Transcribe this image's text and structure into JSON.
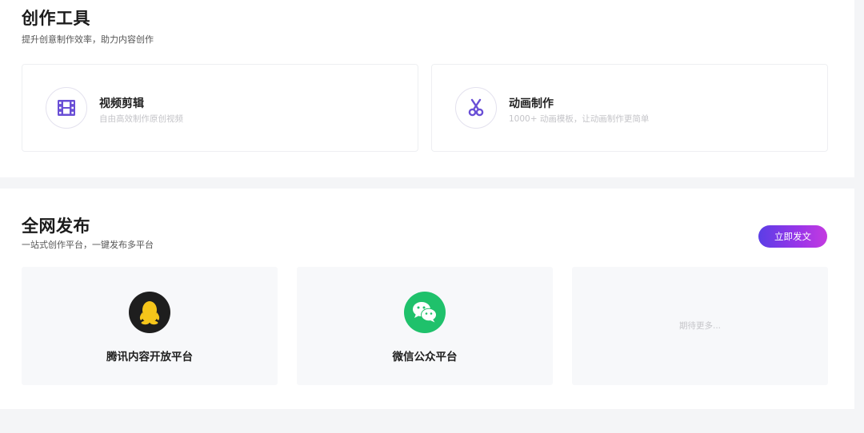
{
  "tools_section": {
    "title": "创作工具",
    "subtitle": "提升创意制作效率，助力内容创作",
    "cards": [
      {
        "icon": "film-icon",
        "name": "视频剪辑",
        "desc": "自由高效制作原创视频"
      },
      {
        "icon": "scissors-icon",
        "name": "动画制作",
        "desc": "1000+ 动画模板，让动画制作更简单"
      }
    ]
  },
  "publish_section": {
    "title": "全网发布",
    "subtitle": "一站式创作平台，一键发布多平台",
    "button_label": "立即发文",
    "platforms": [
      {
        "icon": "qq-penguin-icon",
        "name": "腾讯内容开放平台"
      },
      {
        "icon": "wechat-icon",
        "name": "微信公众平台"
      }
    ],
    "more_label": "期待更多..."
  },
  "colors": {
    "accent_gradient_start": "#5b3ee6",
    "accent_gradient_end": "#c43be0",
    "icon_purple": "#6a4fd6",
    "qq_bg": "#1e1e1e",
    "qq_yellow": "#f5c51a",
    "wechat_green": "#1fc16b"
  }
}
